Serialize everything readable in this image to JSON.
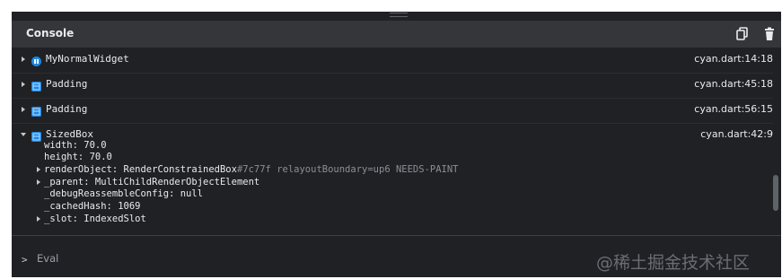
{
  "console": {
    "title": "Console",
    "copy_icon": "copy-icon",
    "delete_icon": "trash-icon"
  },
  "rows": [
    {
      "widget": "MyNormalWidget",
      "icon": "custom-widget-icon",
      "location": "cyan.dart:14:18"
    },
    {
      "widget": "Padding",
      "icon": "layout-widget-icon",
      "location": "cyan.dart:45:18"
    },
    {
      "widget": "Padding",
      "icon": "layout-widget-icon",
      "location": "cyan.dart:56:15"
    },
    {
      "widget": "SizedBox",
      "icon": "layout-widget-icon",
      "location": "cyan.dart:42:9",
      "properties": {
        "width": {
          "key": "width:",
          "value": "70.0"
        },
        "height": {
          "key": "height:",
          "value": "70.0"
        },
        "render_object": {
          "key": "renderObject:",
          "value": "RenderConstrainedBox",
          "detail": "#7c77f relayoutBoundary=up6 NEEDS-PAINT"
        },
        "parent": {
          "key": "_parent:",
          "value": "MultiChildRenderObjectElement"
        },
        "debug_reassemble": {
          "key": "_debugReassembleConfig:",
          "value": "null"
        },
        "cached_hash": {
          "key": "_cachedHash:",
          "value": "1069"
        },
        "slot": {
          "key": "_slot:",
          "value": "IndexedSlot"
        }
      }
    }
  ],
  "eval": {
    "prompt": ">",
    "placeholder": "Eval"
  },
  "watermark": "@稀土掘金技术社区",
  "colors": {
    "background": "#202124",
    "header": "#35363a",
    "widget_icon_blue": "#1e88e5",
    "text": "#e8eaed",
    "dim_text": "#8a8f96"
  }
}
